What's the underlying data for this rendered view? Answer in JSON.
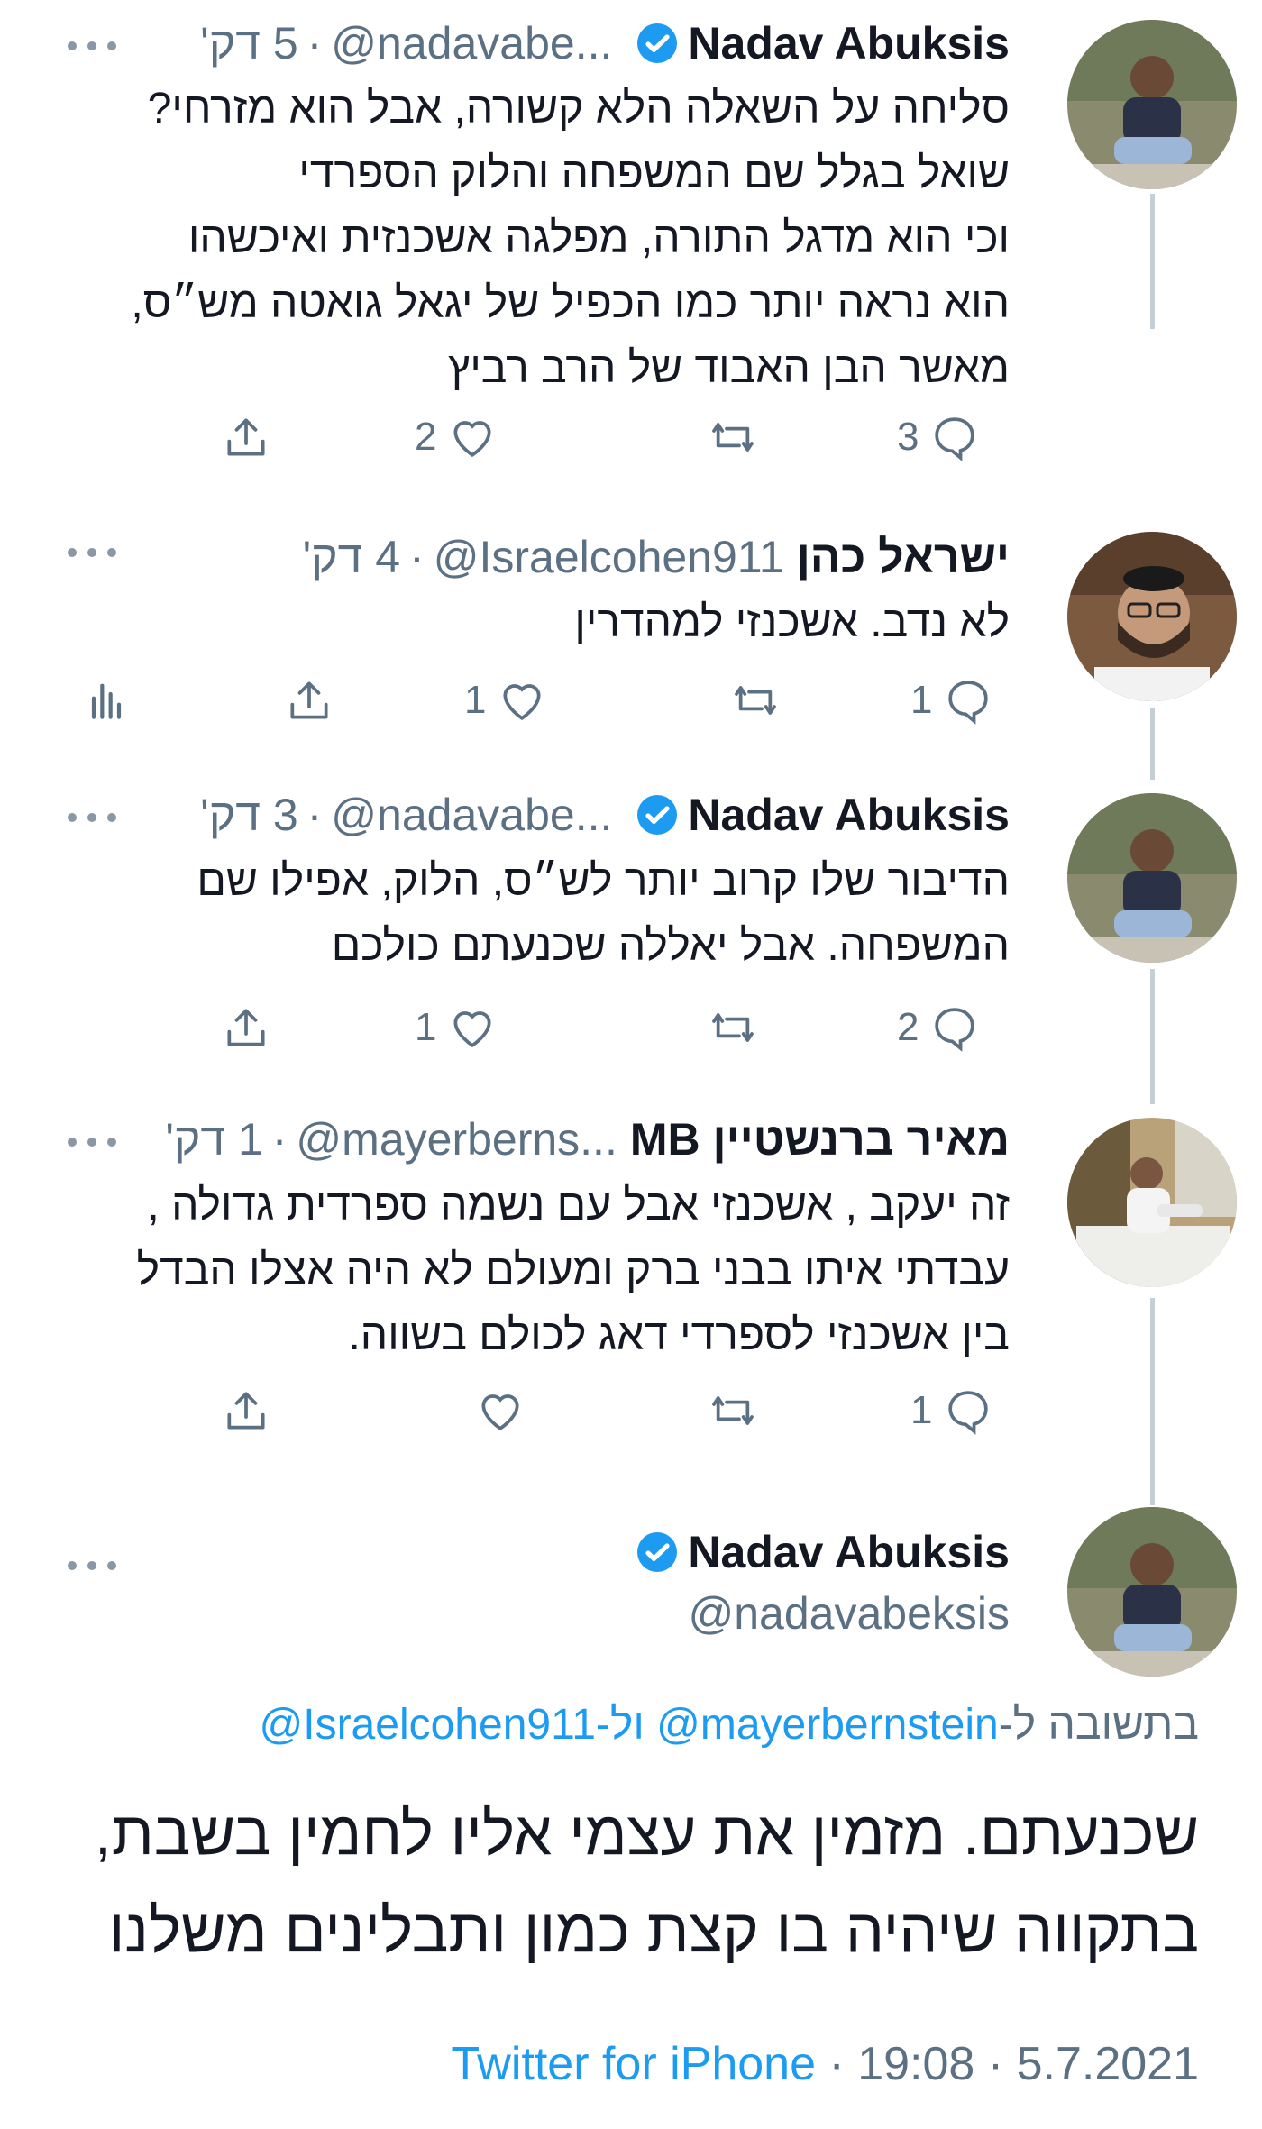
{
  "tweets": [
    {
      "name": "Nadav Abuksis",
      "verified": true,
      "handle": "@nadavabe...",
      "time": "5 דק'",
      "text_lines": [
        "סליחה על השאלה הלא קשורה, אבל הוא מזרחי?",
        "שואל בגלל שם המשפחה והלוק הספרדי",
        "וכי הוא מדגל התורה, מפלגה אשכנזית ואיכשהו",
        "הוא נראה יותר כמו הכפיל של יגאל גואטה  מש״ס,",
        "מאשר הבן האבוד של הרב רביץ"
      ],
      "replies": "3",
      "retweets": "",
      "likes": "2"
    },
    {
      "name": "ישראל כהן",
      "verified": false,
      "handle": "@Israelcohen911",
      "time": "4 דק'",
      "text_lines": [
        "לא נדב. אשכנזי למהדרין"
      ],
      "replies": "1",
      "retweets": "",
      "likes": "1"
    },
    {
      "name": "Nadav Abuksis",
      "verified": true,
      "handle": "@nadavabe...",
      "time": "3 דק'",
      "text_lines": [
        "הדיבור שלו קרוב יותר לש״ס, הלוק, אפילו שם",
        "המשפחה. אבל יאללה שכנעתם כולכם"
      ],
      "replies": "2",
      "retweets": "",
      "likes": "1"
    },
    {
      "name": "מאיר ברנשטיין MB",
      "verified": false,
      "handle": "@mayerberns...",
      "time": "1 דק'",
      "text_lines": [
        "זה יעקב , אשכנזי אבל עם נשמה ספרדית גדולה ,",
        "עבדתי איתו בבני ברק ומעולם לא היה אצלו הבדל",
        "בין אשכנזי לספרדי דאג לכולם בשווה."
      ],
      "replies": "1",
      "retweets": "",
      "likes": ""
    }
  ],
  "main_tweet": {
    "name": "Nadav Abuksis",
    "verified": true,
    "handle": "@nadavabeksis",
    "reply_prefix": "בתשובה ל-",
    "reply_handle_1": "@mayerbernstein",
    "reply_join": "-ול",
    "reply_handle_2": "@Israelcohen911",
    "text_lines": [
      "שכנעתם. מזמין את עצמי אליו לחמין בשבת,",
      "בתקווה שיהיה בו קצת כמון ותבלינים משלנו"
    ],
    "source": "Twitter for iPhone",
    "time": "19:08",
    "date": "5.7.2021"
  },
  "colors": {
    "accent": "#1d9bf0",
    "secondary_text": "#5b7083",
    "thread_line": "#c4cfd6"
  }
}
